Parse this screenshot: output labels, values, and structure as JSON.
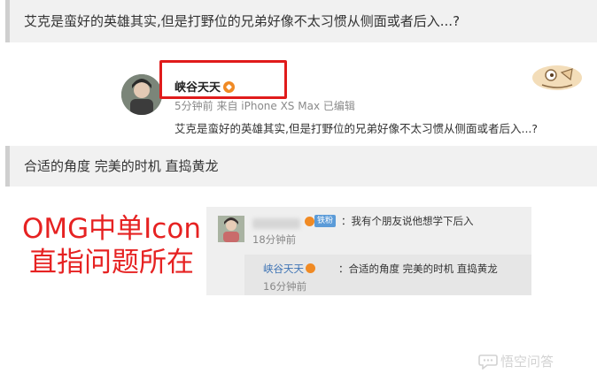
{
  "question": {
    "text": "艾克是蛮好的英雄其实,但是打野位的兄弟好像不太习惯从侧面或者后入...?"
  },
  "post": {
    "username": "峡谷天天",
    "meta": "5分钟前 来自 iPhone XS Max  已编辑",
    "content": "艾克是蛮好的英雄其实,但是打野位的兄弟好像不太习惯从侧面或者后入...?"
  },
  "answer": {
    "text": "合适的角度 完美的时机 直捣黄龙"
  },
  "caption": {
    "line1": "OMG中单Icon",
    "line2": "直指问题所在"
  },
  "comment": {
    "badge": "铁粉",
    "text": "：我有个朋友说他想学下后入",
    "time": "18分钟前",
    "reply": {
      "username": "峡谷天天",
      "text": "：合适的角度 完美的时机 直捣黄龙",
      "time": "16分钟前"
    }
  },
  "watermark": {
    "text": "悟空问答"
  },
  "colors": {
    "highlight": "#e01b1b",
    "caption": "#e62222",
    "link": "#3f74b5",
    "vip": "#f08a24"
  }
}
